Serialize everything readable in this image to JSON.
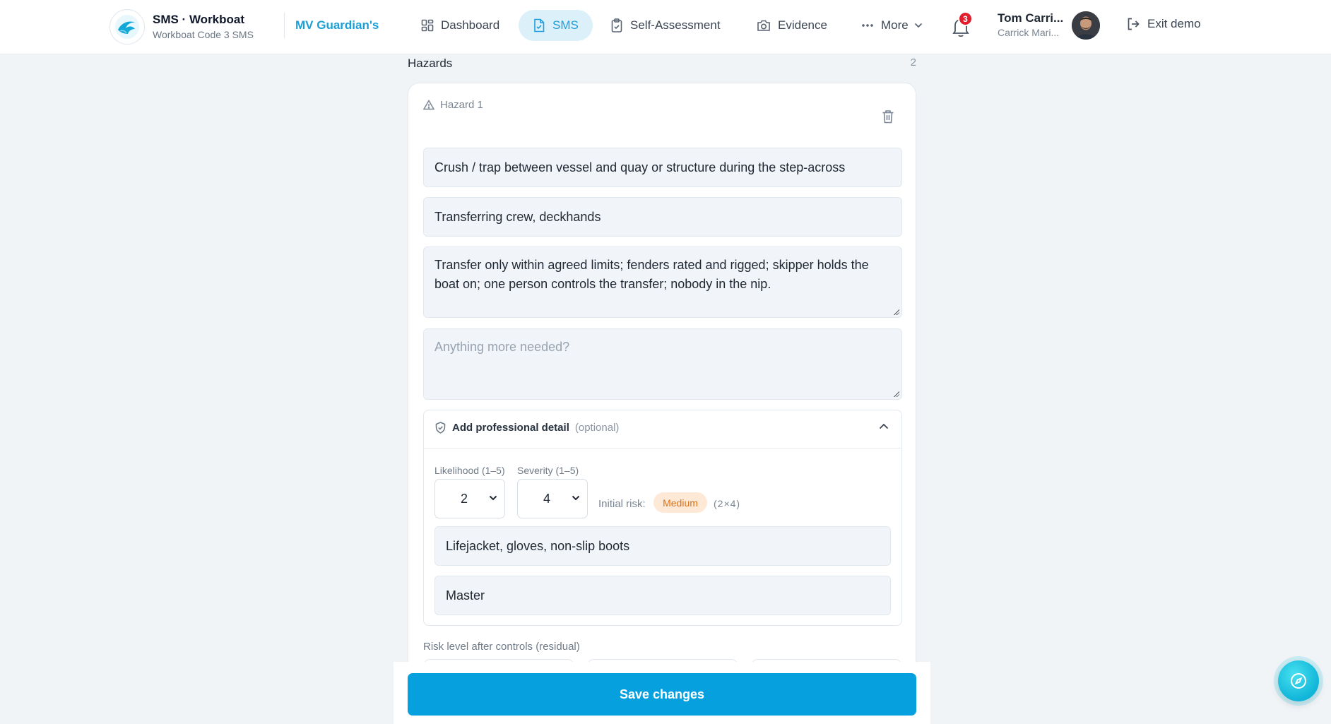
{
  "brand": {
    "title": "SMS · Workboat",
    "subtitle": "Workboat Code 3 SMS",
    "logo_icon": "wave-icon",
    "vessel": "MV Guardian's"
  },
  "nav": {
    "items": [
      {
        "label": "Dashboard",
        "icon": "grid-icon",
        "active": false
      },
      {
        "label": "SMS",
        "icon": "document-icon",
        "active": true
      },
      {
        "label": "Self-Assessment",
        "icon": "clipboard-icon",
        "active": false
      },
      {
        "label": "Evidence",
        "icon": "camera-icon",
        "active": false
      },
      {
        "label": "More",
        "icon": "dots-icon",
        "active": false
      }
    ],
    "notifications_count": "3",
    "user_name": "Tom Carri...",
    "user_org": "Carrick Mari...",
    "exit_label": "Exit demo"
  },
  "section": {
    "title": "Hazards",
    "count": "2"
  },
  "hazard": {
    "label": "Hazard 1",
    "description": "Crush / trap between vessel and quay or structure during the step-across",
    "who_at_risk": "Transferring crew, deckhands",
    "controls": "Transfer only within agreed limits; fenders rated and rigged; skipper holds the boat on; one person controls the transfer; nobody in the nip.",
    "further_actions_placeholder": "Anything more needed?",
    "professional": {
      "title": "Add professional detail",
      "optional": "(optional)",
      "likelihood_label": "Likelihood (1–5)",
      "likelihood_value": "2",
      "severity_label": "Severity (1–5)",
      "severity_value": "4",
      "initial_risk_label": "Initial risk:",
      "initial_risk_value": "Medium",
      "initial_risk_calc": "(2×4)",
      "ppe": "Lifejacket, gloves, non-slip boots",
      "responsible": "Master"
    },
    "residual_label": "Risk level after controls (residual)"
  },
  "footer": {
    "save_label": "Save changes"
  },
  "colors": {
    "accent": "#07a0df",
    "risk_medium_bg": "#fde9d6",
    "risk_medium_text": "#d9731a",
    "badge_red": "#e11d2e"
  }
}
